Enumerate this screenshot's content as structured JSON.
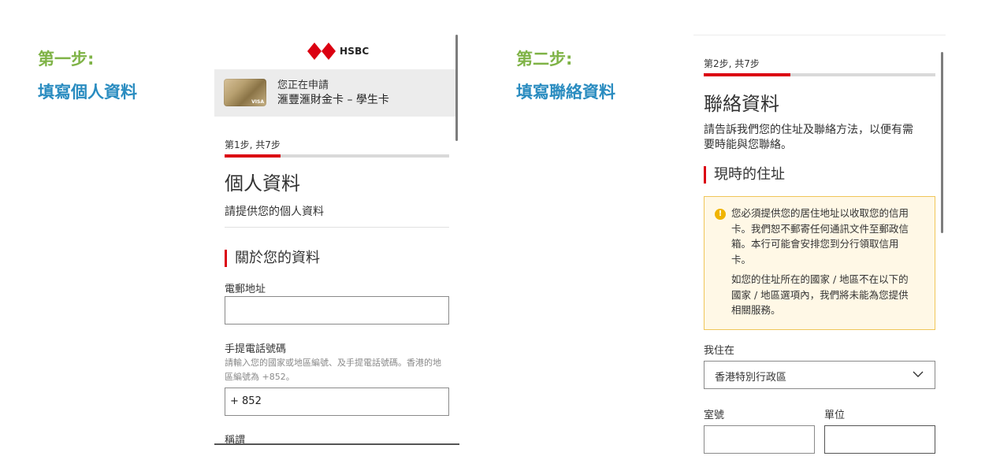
{
  "left_annotation": {
    "step1_label": "第一步:",
    "step1_desc": "填寫個人資料",
    "step2_label": "第二步:",
    "step2_desc": "填寫聯絡資料"
  },
  "phone1": {
    "brand": "HSBC",
    "banner": {
      "line1": "您正在申請",
      "line2": "滙豐滙財金卡 – 學生卡",
      "card_mark": "VISA"
    },
    "progress": {
      "text": "第1步, 共7步",
      "fraction": 0.25
    },
    "title": "個人資料",
    "subtitle": "請提供您的個人資料",
    "section_title": "關於您的資料",
    "email_label": "電郵地址",
    "mobile_label": "手提電話號碼",
    "mobile_hint_line1": "請輸入您的國家或地區編號、及手提電話號碼。香港的地",
    "mobile_hint_line2": "區編號為 +852。",
    "mobile_value": "+ 852",
    "salutation_label": "稱謂"
  },
  "phone2": {
    "progress": {
      "text": "第2步, 共7步",
      "fraction": 0.375
    },
    "title": "聯絡資料",
    "intro_line1": "請告訴我們您的住址及聯絡方法，以便有需",
    "intro_line2": "要時能與您聯絡。",
    "section_title": "現時的住址",
    "notice": {
      "p1_lines": [
        "您必須提供您的居住地址以收取您的信用",
        "卡。我們恕不郵寄任何通訊文件至郵政信",
        "箱。本行可能會安排您到分行領取信用",
        "卡。"
      ],
      "p2_lines": [
        "如您的住址所在的國家 / 地區不在以下的",
        "國家 / 地區選項內，我們將未能為您提供",
        "相關服務。"
      ]
    },
    "live_in_label": "我住在",
    "live_in_value": "香港特別行政區",
    "room_label": "室號",
    "unit_label": "單位"
  },
  "colors": {
    "step_label": "#7fb347",
    "step_desc": "#2a8cc0",
    "accent_red": "#db0011",
    "notice_bg": "#fff8e6",
    "notice_border": "#f0c659"
  }
}
